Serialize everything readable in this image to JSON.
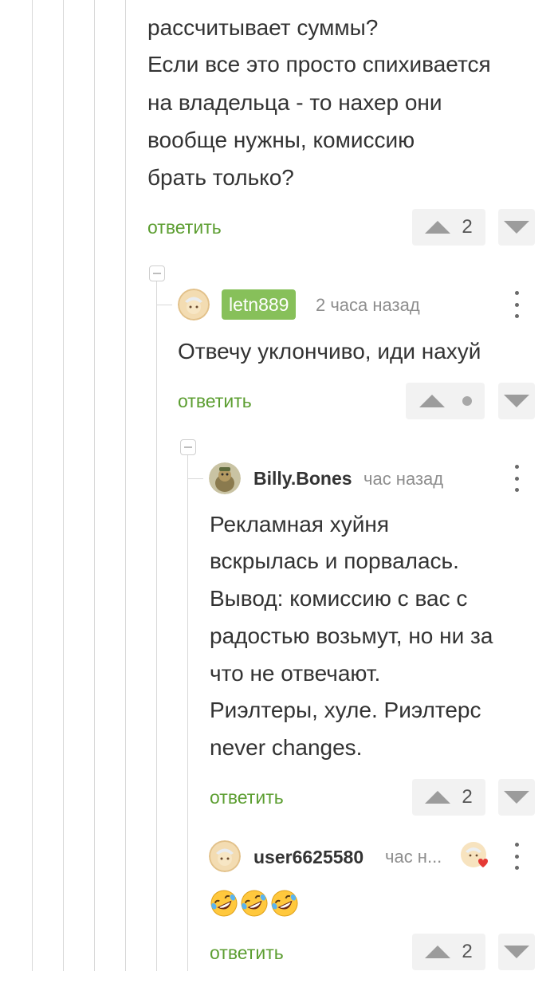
{
  "comment_top": {
    "text_lines": [
      "рассчитывает суммы?",
      "Если все это просто спихивается",
      "на владельца - то нахер они",
      "вообще нужны, комиссию",
      "брать только?"
    ],
    "reply_label": "ответить",
    "score": "2"
  },
  "comment_letn": {
    "username": "letn889",
    "time": "2 часа назад",
    "text": "Отвечу уклончиво, иди нахуй",
    "reply_label": "ответить"
  },
  "comment_billy": {
    "username": "Billy.Bones",
    "time": "час назад",
    "text_lines": [
      "Рекламная хуйня",
      "вскрылась и порвалась.",
      "Вывод: комиссию с вас с",
      "радостью возьмут, но ни за",
      "что не отвечают.",
      "Риэлтеры, хуле. Риэлтерс",
      "never changes."
    ],
    "reply_label": "ответить",
    "score": "2"
  },
  "comment_user": {
    "username": "user6625580",
    "time": "час н...",
    "emoji": [
      "rolling-on-floor-laughing",
      "rolling-on-floor-laughing",
      "rolling-on-floor-laughing"
    ],
    "reply_label": "ответить",
    "score": "2"
  },
  "colors": {
    "accent_green": "#5c9e31",
    "badge_green": "#87c05a",
    "thread_line": "#d8d8d8"
  }
}
